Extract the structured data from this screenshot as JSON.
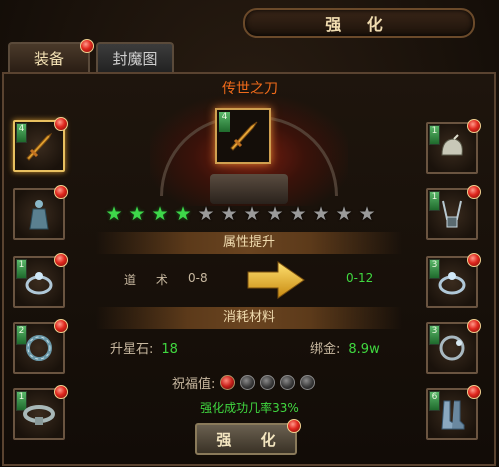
{
  "title": "强 化",
  "tabs": [
    {
      "label": "装备",
      "active": true,
      "has_alert": true
    },
    {
      "label": "封魔图",
      "active": false,
      "has_alert": false
    }
  ],
  "item_name": "传世之刀",
  "center_item": {
    "level": "4",
    "icon": "blade-icon"
  },
  "left_slots": [
    {
      "level": "4",
      "icon": "blade-icon",
      "active": true
    },
    {
      "level": "",
      "icon": "armor-figure-icon",
      "active": false
    },
    {
      "level": "1",
      "icon": "ring-icon",
      "active": false
    },
    {
      "level": "2",
      "icon": "bracelet-icon",
      "active": false
    },
    {
      "level": "1",
      "icon": "belt-icon",
      "active": false
    }
  ],
  "right_slots": [
    {
      "level": "1",
      "icon": "helmet-icon"
    },
    {
      "level": "1",
      "icon": "necklace-icon"
    },
    {
      "level": "3",
      "icon": "ring-icon"
    },
    {
      "level": "3",
      "icon": "bracelet-icon"
    },
    {
      "level": "6",
      "icon": "boots-icon"
    }
  ],
  "stars": {
    "filled": 4,
    "total": 12
  },
  "attribute_header": "属性提升",
  "attribute": {
    "name": "道 术",
    "current": "0-8",
    "next": "0-12"
  },
  "materials_header": "消耗材料",
  "materials": {
    "stone_label": "升星石:",
    "stone_value": "18",
    "gold_label": "绑金:",
    "gold_value": "8.9w"
  },
  "blessing": {
    "label": "祝福值:",
    "filled": 1,
    "total": 5
  },
  "success_rate_text": "强化成功几率33%",
  "enhance_button": "强 化",
  "colors": {
    "accent_green": "#40d840",
    "item_name": "#f06a1a",
    "alert_red": "#e0281e"
  }
}
